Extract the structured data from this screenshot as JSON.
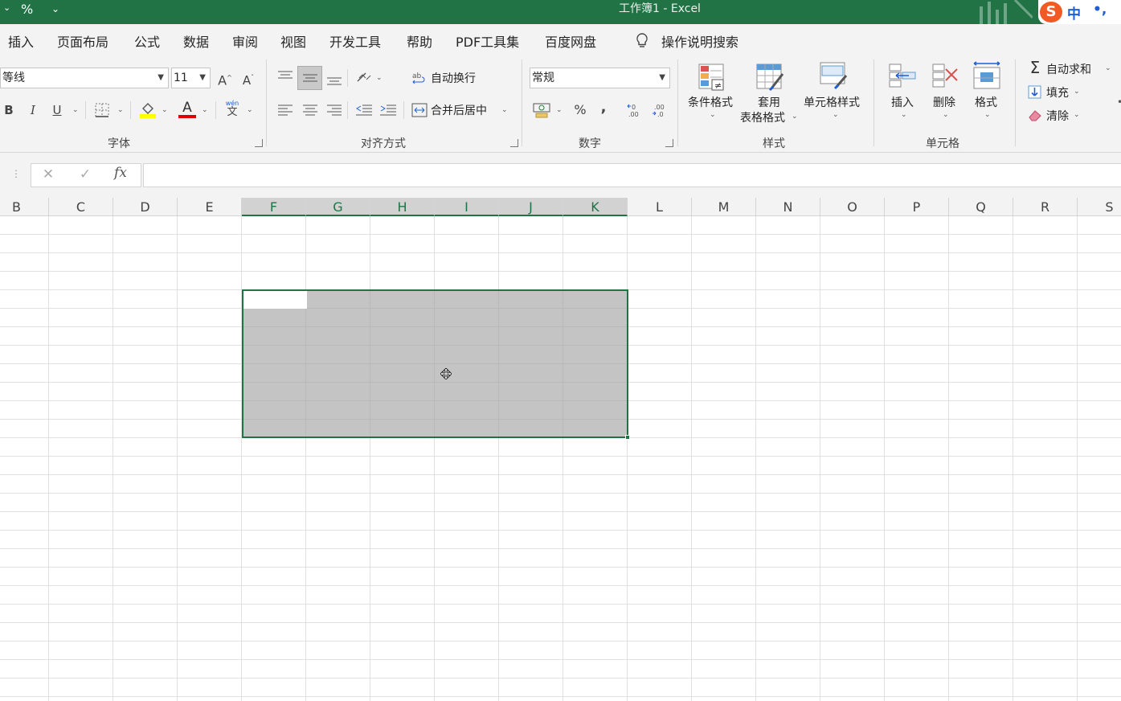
{
  "titlebar": {
    "title": "工作簿1  -  Excel",
    "qa_percent": "%",
    "qa_customize": "⌄",
    "ime_logo": "S",
    "ime_mode": "中",
    "ime_punct": "•,"
  },
  "menu": {
    "tabs": [
      "插入",
      "页面布局",
      "公式",
      "数据",
      "审阅",
      "视图",
      "开发工具",
      "帮助",
      "PDF工具集",
      "百度网盘"
    ],
    "tell_me": "操作说明搜索"
  },
  "ribbon": {
    "font": {
      "name": "等线",
      "size": "11",
      "grow": "A",
      "shrink": "A",
      "bold": "B",
      "italic": "I",
      "underline": "U",
      "font_color_letter": "A",
      "phonetic_top": "wén",
      "phonetic_bottom": "文",
      "group_label": "字体"
    },
    "alignment": {
      "wrap_text": "自动换行",
      "merge_center": "合并后居中",
      "group_label": "对齐方式"
    },
    "number": {
      "format": "常规",
      "percent": "%",
      "comma": ",",
      "group_label": "数字"
    },
    "styles": {
      "conditional": "条件格式",
      "table_format_1": "套用",
      "table_format_2": "表格格式",
      "cell_styles": "单元格样式",
      "group_label": "样式"
    },
    "cells": {
      "insert": "插入",
      "delete": "删除",
      "format": "格式",
      "group_label": "单元格"
    },
    "editing": {
      "autosum": "自动求和",
      "fill": "填充",
      "clear": "清除"
    }
  },
  "formula_bar": {
    "cancel": "✕",
    "enter": "✓",
    "fx": "fx"
  },
  "sheet": {
    "columns": [
      "B",
      "C",
      "D",
      "E",
      "F",
      "G",
      "H",
      "I",
      "J",
      "K",
      "L",
      "M",
      "N",
      "O",
      "P",
      "Q",
      "R",
      "S"
    ],
    "selected_columns": [
      "F",
      "G",
      "H",
      "I",
      "J",
      "K"
    ]
  },
  "colors": {
    "accent": "#217346",
    "selection": "#c6c6c6"
  }
}
